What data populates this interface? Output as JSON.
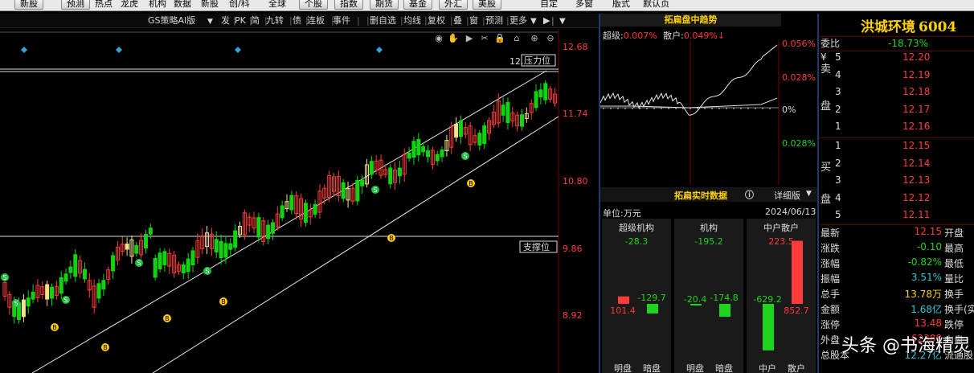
{
  "menu": {
    "items": [
      "新股",
      "预测",
      "热点",
      "龙虎",
      "机构",
      "数据",
      "新股",
      "创/科",
      "全球",
      "个股",
      "指数",
      "期货",
      "基金",
      "外汇",
      "美股",
      "自定",
      "多窗",
      "版式",
      "默认页"
    ],
    "button_idx": [
      0,
      1,
      9,
      10,
      11,
      12,
      13,
      14
    ]
  },
  "toolbar": {
    "strategy": "GS策略AI版",
    "items": [
      "发",
      "PK",
      "简",
      "九转",
      "债",
      "连板",
      "事件",
      "删自选",
      "均线",
      "复权",
      "叠",
      "窗",
      "预测",
      "更多"
    ],
    "dropdown_arrow": "▼",
    "play": "▶"
  },
  "kchart": {
    "price_axis": [
      "12.68",
      "11.74",
      "10.80",
      "9.86",
      "8.92"
    ],
    "pressure_label": "压力位",
    "pressure_prefix": "12.",
    "support_label": "支撑位",
    "signal_s": "S",
    "signal_b": "B"
  },
  "minichart": {
    "title": "拓扁盘中趋势",
    "super_label": "超级:",
    "super_val": "0.007%",
    "retail_label": "散户:",
    "retail_val": "0.049%↓",
    "axis": [
      "0.056%",
      "0.028%",
      "0%",
      "0.028%"
    ]
  },
  "flow": {
    "title": "拓扁实时数据",
    "detail": "详细版",
    "info_icon": "ⓘ",
    "unit": "单位:万元",
    "date": "2024/06/13",
    "groups": [
      {
        "name": "超级机构",
        "total": "-28.3",
        "in": "101.4",
        "out": "-129.7",
        "in_label": "明盘",
        "out_label": "暗盘"
      },
      {
        "name": "机构",
        "total": "-195.2",
        "in": "-20.4",
        "out": "-174.8",
        "in_label": "明盘",
        "out_label": "暗盘"
      },
      {
        "name": "中户散户",
        "total": "223.5",
        "in": "-629.2",
        "out": "852.7",
        "in_label": "中户",
        "out_label": "散户"
      }
    ]
  },
  "stock": {
    "name": "洪城环境",
    "code": "6004",
    "webi_label": "委比",
    "webi": "-18.73%",
    "sell_label": [
      "卖",
      "盘"
    ],
    "buy_label": [
      "买",
      "盘"
    ],
    "asks": [
      {
        "lv": "5",
        "p": "12.20"
      },
      {
        "lv": "4",
        "p": "12.19"
      },
      {
        "lv": "3",
        "p": "12.18"
      },
      {
        "lv": "2",
        "p": "12.17"
      },
      {
        "lv": "1",
        "p": "12.16"
      }
    ],
    "bids": [
      {
        "lv": "1",
        "p": "12.15"
      },
      {
        "lv": "2",
        "p": "12.14"
      },
      {
        "lv": "3",
        "p": "12.13"
      },
      {
        "lv": "4",
        "p": "12.12"
      },
      {
        "lv": "5",
        "p": "12.11"
      }
    ],
    "currency": "¥",
    "stats": [
      {
        "l": "最新",
        "v": "12.15",
        "r": "开盘",
        "c": "red"
      },
      {
        "l": "涨跌",
        "v": "-0.10",
        "r": "最高",
        "c": "green"
      },
      {
        "l": "涨幅",
        "v": "-0.82%",
        "r": "最低",
        "c": "green"
      },
      {
        "l": "振幅",
        "v": "3.51%",
        "r": "量比",
        "c": "cyan"
      },
      {
        "l": "总手",
        "v": "13.78万",
        "r": "换手",
        "c": "yellow"
      },
      {
        "l": "金额",
        "v": "1.68亿",
        "r": "换手(实",
        "c": "cyan"
      },
      {
        "l": "涨停",
        "v": "13.48",
        "r": "跌停",
        "c": "red"
      },
      {
        "l": "外盘",
        "v": "62388",
        "r": "内盘",
        "c": "red"
      },
      {
        "l": "总股本",
        "v": "12.27亿",
        "r": "流通股",
        "c": "cyan"
      }
    ]
  },
  "watermark": "头条 @书海精灵"
}
